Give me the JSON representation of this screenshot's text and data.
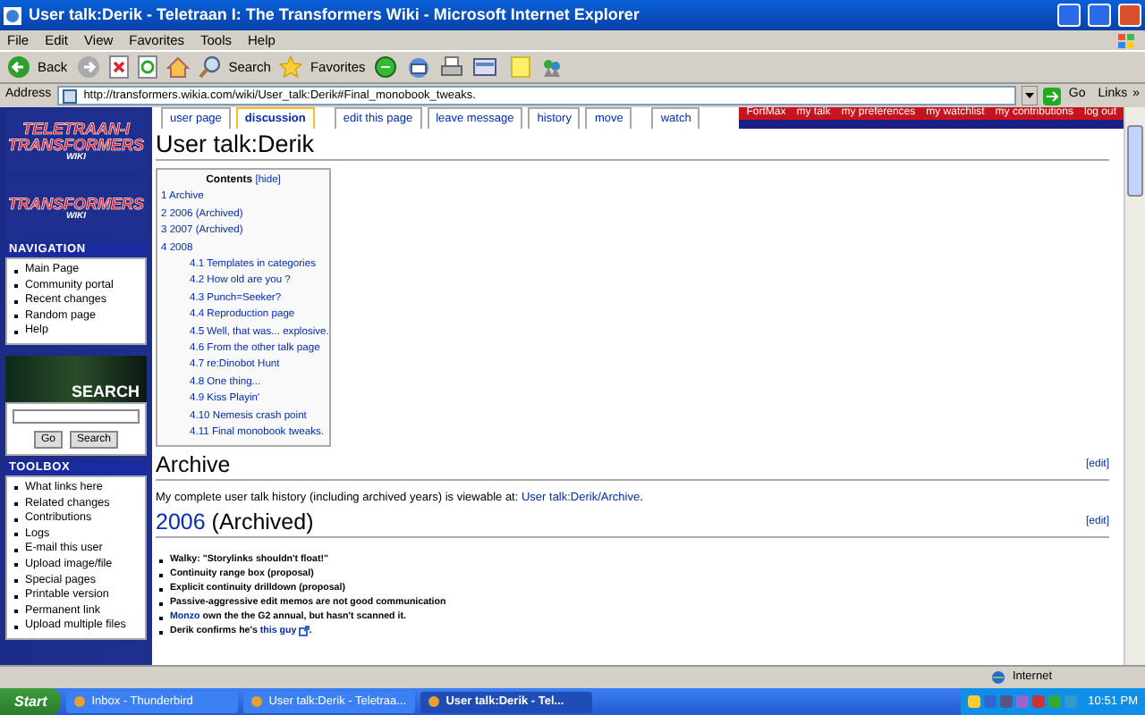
{
  "window": {
    "title": "User talk:Derik - Teletraan I: The Transformers Wiki - Microsoft Internet Explorer"
  },
  "menu": [
    "File",
    "Edit",
    "View",
    "Favorites",
    "Tools",
    "Help"
  ],
  "toolbar": {
    "back": "Back",
    "search": "Search",
    "favorites": "Favorites"
  },
  "address": {
    "label": "Address",
    "url": "http://transformers.wikia.com/wiki/User_talk:Derik#Final_monobook_tweaks.",
    "go": "Go",
    "links": "Links",
    "more": "»"
  },
  "sidebar": {
    "logos": [
      {
        "lines": [
          "TELETRAAN-I",
          "TRANSFORMERS",
          "WIKI"
        ]
      },
      {
        "lines": [
          "TRANSFORMERS",
          "WIKI"
        ]
      }
    ],
    "navigation": {
      "title": "NAVIGATION",
      "items": [
        "Main Page",
        "Community portal",
        "Recent changes",
        "Random page",
        "Help"
      ]
    },
    "search": {
      "title": "SEARCH",
      "go": "Go",
      "search": "Search"
    },
    "toolbox": {
      "title": "TOOLBOX",
      "items": [
        "What links here",
        "Related changes",
        "Contributions",
        "Logs",
        "E-mail this user",
        "Upload image/file",
        "Special pages",
        "Printable version",
        "Permanent link",
        "Upload multiple files"
      ]
    }
  },
  "personal": [
    "FortMax",
    "my talk",
    "my preferences",
    "my watchlist",
    "my contributions",
    "log out"
  ],
  "tabs": [
    {
      "label": "user page",
      "selected": false
    },
    {
      "label": "discussion",
      "selected": true
    },
    {
      "label": "edit this page",
      "selected": false
    },
    {
      "label": "leave message",
      "selected": false
    },
    {
      "label": "history",
      "selected": false
    },
    {
      "label": "move",
      "selected": false
    },
    {
      "label": "watch",
      "selected": false
    }
  ],
  "page_title": "User talk:Derik",
  "toc": {
    "title": "Contents",
    "hide": "[hide]",
    "items": [
      {
        "number": "1",
        "text": "Archive"
      },
      {
        "number": "2",
        "text": "2006 (Archived)"
      },
      {
        "number": "3",
        "text": "2007 (Archived)"
      },
      {
        "number": "4",
        "text": "2008",
        "children": [
          {
            "number": "4.1",
            "text": "Templates in categories"
          },
          {
            "number": "4.2",
            "text": "How old are you ?"
          },
          {
            "number": "4.3",
            "text": "Punch=Seeker?"
          },
          {
            "number": "4.4",
            "text": "Reproduction page"
          },
          {
            "number": "4.5",
            "text": "Well, that was... explosive."
          },
          {
            "number": "4.6",
            "text": "From the other talk page"
          },
          {
            "number": "4.7",
            "text": "re:Dinobot Hunt"
          },
          {
            "number": "4.8",
            "text": "One thing..."
          },
          {
            "number": "4.9",
            "text": "Kiss Playin'"
          },
          {
            "number": "4.10",
            "text": "Nemesis crash point"
          },
          {
            "number": "4.11",
            "text": "Final monobook tweaks."
          }
        ]
      }
    ]
  },
  "sections": [
    {
      "heading": "Archive",
      "edit": "[edit]",
      "paragraph": {
        "text": "My complete user talk history (including archived years) is viewable at: ",
        "link": "User talk:Derik/Archive",
        "after": "."
      }
    },
    {
      "heading_link": "2006",
      "heading": " (Archived)",
      "edit": "[edit]",
      "items": [
        {
          "text": "Walky: \"Storylinks shouldn't float!\""
        },
        {
          "text": "Continuity range box (proposal)"
        },
        {
          "text": "Explicit continuity drilldown (proposal)"
        },
        {
          "text": "Passive-aggressive edit memos are not good communication"
        },
        {
          "link": "Monzo",
          "after": " own the the G2 annual, but hasn't scanned it."
        },
        {
          "text": "Derik confirms he's ",
          "link": "this guy",
          "external": true,
          "after": "."
        }
      ]
    }
  ],
  "status": {
    "zone": "Internet"
  },
  "taskbar": {
    "start": "Start",
    "tasks": [
      {
        "label": "Inbox - Thunderbird",
        "selected": false
      },
      {
        "label": "User talk:Derik - Teletraa...",
        "selected": false
      },
      {
        "label": "User talk:Derik - Tel...",
        "selected": true
      }
    ],
    "clock": "10:51 PM"
  }
}
